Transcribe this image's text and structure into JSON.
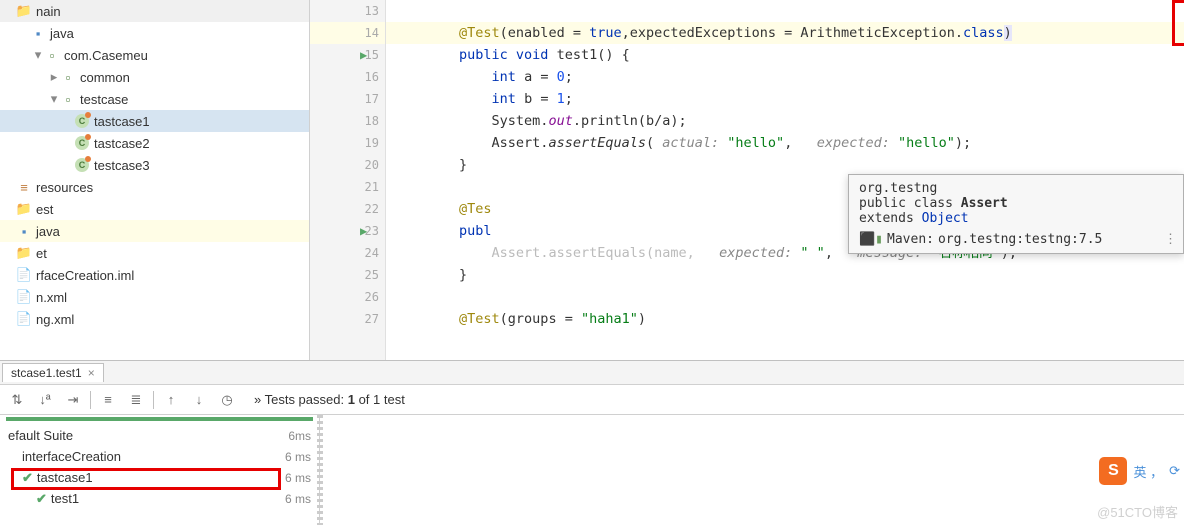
{
  "sidebar": {
    "items": [
      {
        "label": "nain",
        "icon": "folder",
        "indent": 0,
        "chev": ""
      },
      {
        "label": "java",
        "icon": "java",
        "indent": 1,
        "chev": ""
      },
      {
        "label": "com.Casemeu",
        "icon": "pkg",
        "indent": 2,
        "chev": "▾"
      },
      {
        "label": "common",
        "icon": "pkg",
        "indent": 3,
        "chev": "▸"
      },
      {
        "label": "testcase",
        "icon": "pkg",
        "indent": 3,
        "chev": "▾"
      },
      {
        "label": "tastcase1",
        "icon": "class",
        "indent": 4,
        "chev": "",
        "sel": true
      },
      {
        "label": "tastcase2",
        "icon": "class",
        "indent": 4,
        "chev": ""
      },
      {
        "label": "testcase3",
        "icon": "class",
        "indent": 4,
        "chev": ""
      },
      {
        "label": "resources",
        "icon": "res",
        "indent": 0,
        "chev": ""
      },
      {
        "label": "est",
        "icon": "folder",
        "indent": 0,
        "chev": ""
      },
      {
        "label": "java",
        "icon": "java",
        "indent": 0,
        "chev": "",
        "hl": true
      },
      {
        "label": "et",
        "icon": "folder",
        "indent": 0,
        "chev": ""
      },
      {
        "label": "rfaceCreation.iml",
        "icon": "file",
        "indent": 0,
        "chev": ""
      },
      {
        "label": "n.xml",
        "icon": "file",
        "indent": 0,
        "chev": ""
      },
      {
        "label": "ng.xml",
        "icon": "file",
        "indent": 0,
        "chev": ""
      }
    ]
  },
  "gutter": {
    "lines": [
      13,
      14,
      15,
      16,
      17,
      18,
      19,
      20,
      21,
      22,
      23,
      24,
      25,
      26,
      27
    ],
    "hl_line": 14,
    "run_marks": [
      15,
      23
    ]
  },
  "code": {
    "lines": {
      "13": "",
      "14_anno": "@Test",
      "14_txt": "(enabled = ",
      "14_kw": "true",
      "14_txt2": ",expectedExceptions = ArithmeticException.",
      "14_cls": "class",
      "14_end": ")",
      "15_kw": "public void",
      "15_name": " test1() {",
      "16_kw": "int",
      "16_txt": " a = ",
      "16_num": "0",
      "16_end": ";",
      "17_kw": "int",
      "17_txt": " b = ",
      "17_num": "1",
      "17_end": ";",
      "18_sys": "System.",
      "18_out": "out",
      "18_prn": ".println(b/a);",
      "19_as": "Assert.",
      "19_ae": "assertEquals",
      "19_open": "( ",
      "19_p1": "actual:",
      "19_v1": " \"hello\"",
      "19_c": ",   ",
      "19_p2": "expected:",
      "19_v2": " \"hello\"",
      "19_close": ");",
      "20": "}",
      "22_anno": "@Tes",
      "23_kw": "publ",
      "24_txt": "Assert.assertEquals(name,",
      "24_p1": "   expected:",
      "24_v1": " \" \"",
      "24_c": ",   ",
      "24_p2": "message:",
      "24_v2": " \"名称相同\"",
      "24_end": ");",
      "25": "}",
      "27_anno": "@Test",
      "27_txt": "(groups = ",
      "27_str": "\"haha1\"",
      "27_end": ")"
    }
  },
  "tooltip": {
    "pkg": "org.testng",
    "decl": "public class ",
    "name": "Assert",
    "ext": "extends ",
    "obj": "Object",
    "maven_label": "Maven: ",
    "maven": "org.testng:testng:7.5"
  },
  "run_tab": {
    "label": "stcase1.test1"
  },
  "tests_status": {
    "prefix": "»   Tests passed: ",
    "passed": "1",
    "suffix": " of 1 test"
  },
  "test_rows": [
    {
      "name": "efault Suite",
      "time": "6ms",
      "indent": 0
    },
    {
      "name": "interfaceCreation",
      "time": "6 ms",
      "indent": 1
    },
    {
      "name": "tastcase1",
      "time": "6 ms",
      "indent": 1,
      "check": true
    },
    {
      "name": "test1",
      "time": "6 ms",
      "indent": 2,
      "check": true,
      "sel": true
    }
  ],
  "sogou": {
    "text": "英 ，"
  },
  "watermark": "@51CTO博客"
}
